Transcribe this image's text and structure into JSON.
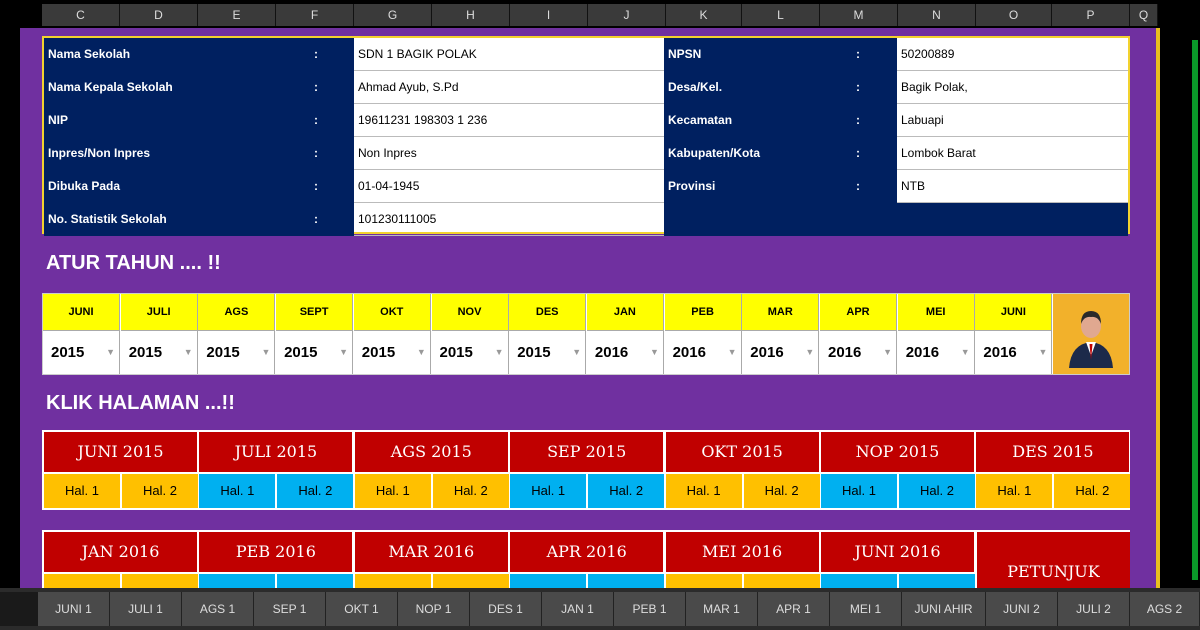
{
  "column_headers": [
    "C",
    "D",
    "E",
    "F",
    "G",
    "H",
    "I",
    "J",
    "K",
    "L",
    "M",
    "N",
    "O",
    "P",
    "Q"
  ],
  "school_info": {
    "left": [
      {
        "label": "Nama Sekolah",
        "colon": ":",
        "value": "SDN 1 BAGIK POLAK"
      },
      {
        "label": "Nama Kepala Sekolah",
        "colon": ":",
        "value": "Ahmad Ayub, S.Pd"
      },
      {
        "label": "NIP",
        "colon": ":",
        "value": "19611231 198303 1 236"
      },
      {
        "label": "Inpres/Non Inpres",
        "colon": ":",
        "value": "Non Inpres"
      },
      {
        "label": "Dibuka Pada",
        "colon": ":",
        "value": "01-04-1945"
      },
      {
        "label": "No. Statistik Sekolah",
        "colon": ":",
        "value": "101230111005"
      }
    ],
    "right": [
      {
        "label": "NPSN",
        "colon": ":",
        "value": "50200889"
      },
      {
        "label": "Desa/Kel.",
        "colon": ":",
        "value": "Bagik Polak,"
      },
      {
        "label": "Kecamatan",
        "colon": ":",
        "value": "Labuapi"
      },
      {
        "label": "Kabupaten/Kota",
        "colon": ":",
        "value": "Lombok Barat"
      },
      {
        "label": "Provinsi",
        "colon": ":",
        "value": "NTB"
      }
    ]
  },
  "heading_year": "ATUR TAHUN .... !!",
  "heading_pages": "KLIK HALAMAN ...!!",
  "year_settings": [
    {
      "month": "JUNI",
      "year": "2015"
    },
    {
      "month": "JULI",
      "year": "2015"
    },
    {
      "month": "AGS",
      "year": "2015"
    },
    {
      "month": "SEPT",
      "year": "2015"
    },
    {
      "month": "OKT",
      "year": "2015"
    },
    {
      "month": "NOV",
      "year": "2015"
    },
    {
      "month": "DES",
      "year": "2015"
    },
    {
      "month": "JAN",
      "year": "2016"
    },
    {
      "month": "PEB",
      "year": "2016"
    },
    {
      "month": "MAR",
      "year": "2016"
    },
    {
      "month": "APR",
      "year": "2016"
    },
    {
      "month": "MEI",
      "year": "2016"
    },
    {
      "month": "JUNI",
      "year": "2016"
    }
  ],
  "dropdown_glyph": "▼",
  "pages_row1": [
    {
      "title": "JUNI 2015",
      "hal1": "Hal. 1",
      "hal2": "Hal. 2",
      "color": "orange"
    },
    {
      "title": "JULI 2015",
      "hal1": "Hal. 1",
      "hal2": "Hal. 2",
      "color": "blue"
    },
    {
      "title": "AGS 2015",
      "hal1": "Hal. 1",
      "hal2": "Hal. 2",
      "color": "orange"
    },
    {
      "title": "SEP 2015",
      "hal1": "Hal. 1",
      "hal2": "Hal. 2",
      "color": "blue"
    },
    {
      "title": "OKT 2015",
      "hal1": "Hal. 1",
      "hal2": "Hal. 2",
      "color": "orange"
    },
    {
      "title": "NOP 2015",
      "hal1": "Hal. 1",
      "hal2": "Hal. 2",
      "color": "blue"
    },
    {
      "title": "DES 2015",
      "hal1": "Hal. 1",
      "hal2": "Hal. 2",
      "color": "orange"
    }
  ],
  "pages_row2": [
    {
      "title": "JAN 2016"
    },
    {
      "title": "PEB 2016"
    },
    {
      "title": "MAR 2016"
    },
    {
      "title": "APR 2016"
    },
    {
      "title": "MEI 2016"
    },
    {
      "title": "JUNI 2016"
    }
  ],
  "petunjuk_label": "PETUNJUK",
  "sheet_tabs": [
    "JUNI 1",
    "JULI 1",
    "AGS 1",
    "SEP 1",
    "OKT 1",
    "NOP 1",
    "DES 1",
    "JAN 1",
    "PEB 1",
    "MAR 1",
    "APR 1",
    "MEI 1",
    "JUNI AHIR",
    "JUNI 2",
    "JULI 2",
    "AGS 2"
  ],
  "colors": {
    "sheet_bg": "#7030a0",
    "navy": "#002060",
    "yellow": "#ffff00",
    "red": "#c00000",
    "orange": "#ffc000",
    "blue": "#00b0f0"
  }
}
